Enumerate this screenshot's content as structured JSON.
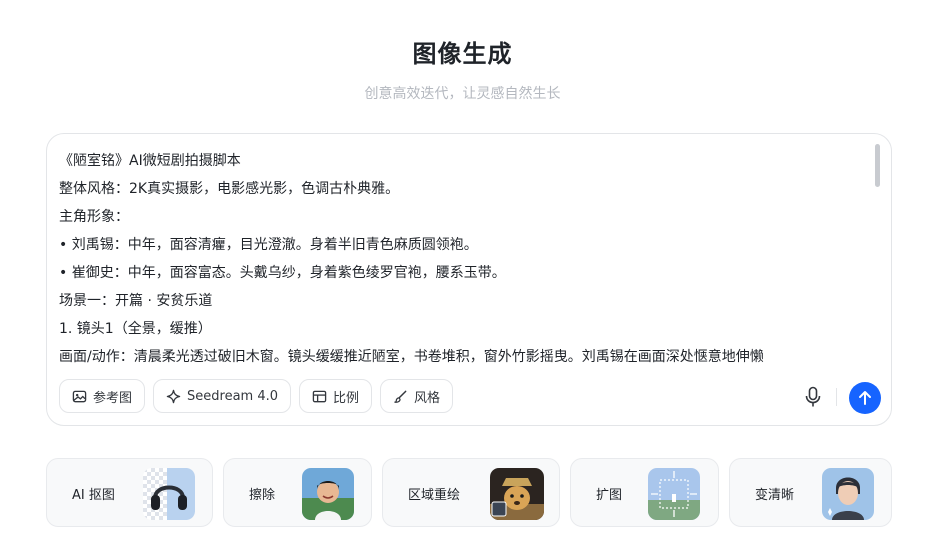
{
  "header": {
    "title": "图像生成",
    "subtitle": "创意高效迭代，让灵感自然生长"
  },
  "prompt": {
    "lines": [
      "《陋室铭》AI微短剧拍摄脚本",
      "整体风格：2K真实摄影，电影感光影，色调古朴典雅。",
      "主角形象：",
      "•  刘禹锡：中年，面容清癯，目光澄澈。身着半旧青色麻质圆领袍。",
      "•  崔御史：中年，面容富态。头戴乌纱，身着紫色绫罗官袍，腰系玉带。",
      "场景一：开篇 · 安贫乐道",
      "1. 镜头1（全景，缓推）",
      "画面/动作：清晨柔光透过破旧木窗。镜头缓缓推近陋室，书卷堆积，窗外竹影摇曳。刘禹锡在画面深处惬意地伸懒"
    ]
  },
  "toolbar": {
    "reference_label": "参考图",
    "model_label": "Seedream 4.0",
    "ratio_label": "比例",
    "style_label": "风格"
  },
  "tools": [
    {
      "label": "AI 抠图",
      "icon": "headphones-cutout-thumbnail"
    },
    {
      "label": "擦除",
      "icon": "child-portrait-thumbnail"
    },
    {
      "label": "区域重绘",
      "icon": "dog-inpaint-thumbnail"
    },
    {
      "label": "扩图",
      "icon": "outpaint-landscape-thumbnail"
    },
    {
      "label": "变清晰",
      "icon": "portrait-enhance-thumbnail"
    }
  ],
  "colors": {
    "accent": "#1664ff",
    "subtitle": "#b4b8bf",
    "border": "#e3e5e8"
  }
}
